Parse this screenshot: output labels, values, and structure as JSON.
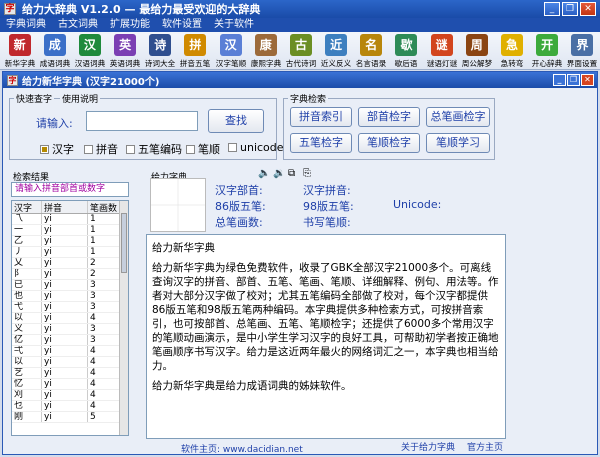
{
  "window": {
    "title": "给力大辞典 V1.2.0  — 最给力最受欢迎的大辞典"
  },
  "menu": [
    "字典词典",
    "古文词典",
    "扩展功能",
    "软件设置",
    "关于软件"
  ],
  "toolbar": [
    {
      "label": "新华字典",
      "icon": "dict-book-icon",
      "color": "#c0282d"
    },
    {
      "label": "成语词典",
      "icon": "idiom-book-icon",
      "color": "#3b6fc8"
    },
    {
      "label": "汉语词典",
      "icon": "chinese-book-icon",
      "color": "#1f8a3c"
    },
    {
      "label": "英语词典",
      "icon": "english-book-icon",
      "color": "#7b3fb3"
    },
    {
      "label": "诗词大全",
      "icon": "poem-icon",
      "color": "#2f4f8f"
    },
    {
      "label": "拼音五笔",
      "icon": "pinyin-icon",
      "color": "#d08a00"
    },
    {
      "label": "汉字笔顺",
      "icon": "stroke-icon",
      "color": "#5a7fd6"
    },
    {
      "label": "康熙字典",
      "icon": "kangxi-icon",
      "color": "#9c6a3a"
    },
    {
      "label": "古代诗词",
      "icon": "ancient-poem-icon",
      "color": "#6b8e23"
    },
    {
      "label": "近义反义",
      "icon": "synonym-icon",
      "color": "#3d7fbf"
    },
    {
      "label": "名言语录",
      "icon": "quote-icon",
      "color": "#b8860b"
    },
    {
      "label": "歇后语",
      "icon": "proverb-icon",
      "color": "#2e8b57"
    },
    {
      "label": "谜语灯谜",
      "icon": "riddle-icon",
      "color": "#d2451e"
    },
    {
      "label": "周公解梦",
      "icon": "dream-icon",
      "color": "#8b4513"
    },
    {
      "label": "急转弯",
      "icon": "brain-teaser-icon",
      "color": "#e0b000"
    },
    {
      "label": "开心辞典",
      "icon": "happy-dict-icon",
      "color": "#3caa3c"
    },
    {
      "label": "界面设置",
      "icon": "settings-gear-icon",
      "color": "#4a6fa5"
    }
  ],
  "subwindow": {
    "title": "给力新华字典    (汉字21000个)"
  },
  "quick_search": {
    "group_label": "快速查字",
    "help_label": "使用说明",
    "input_label": "请输入:",
    "input_value": "",
    "search_button": "查找",
    "modes": [
      {
        "label": "汉字",
        "checked": true
      },
      {
        "label": "拼音",
        "checked": false
      },
      {
        "label": "五笔编码",
        "checked": false
      },
      {
        "label": "笔顺",
        "checked": false
      },
      {
        "label": "unicode",
        "checked": false
      }
    ]
  },
  "char_search": {
    "group_label": "字典检索",
    "buttons": [
      "拼音索引",
      "部首检字",
      "总笔画检字",
      "五笔检字",
      "笔顺检字",
      "笔顺学习"
    ]
  },
  "results": {
    "group_label": "检索结果",
    "filter_placeholder": "请输入拼音部首或数字",
    "columns": [
      "汉字",
      "拼音",
      "笔画数"
    ],
    "rows": [
      [
        "乁",
        "yi",
        "1"
      ],
      [
        "一",
        "yi",
        "1"
      ],
      [
        "乙",
        "yi",
        "1"
      ],
      [
        "丿",
        "yi",
        "1"
      ],
      [
        "乂",
        "yi",
        "2"
      ],
      [
        "阝",
        "yi",
        "2"
      ],
      [
        "已",
        "yi",
        "3"
      ],
      [
        "也",
        "yi",
        "3"
      ],
      [
        "弋",
        "yi",
        "3"
      ],
      [
        "以",
        "yi",
        "4"
      ],
      [
        "义",
        "yi",
        "3"
      ],
      [
        "亿",
        "yi",
        "3"
      ],
      [
        "弌",
        "yi",
        "4"
      ],
      [
        "以",
        "yi",
        "4"
      ],
      [
        "艺",
        "yi",
        "4"
      ],
      [
        "忆",
        "yi",
        "4"
      ],
      [
        "刈",
        "yi",
        "4"
      ],
      [
        "乜",
        "yi",
        "4"
      ],
      [
        "刚",
        "yi",
        "5"
      ]
    ]
  },
  "dictionary": {
    "group_label": "给力字典",
    "fields": {
      "radical": "汉字部首:",
      "pinyin": "汉字拼音:",
      "wubi86": "86版五笔:",
      "wubi98": "98版五笔:",
      "unicode": "Unicode:",
      "strokes": "总笔画数:",
      "stroke_order": "书写笔顺:"
    },
    "content": [
      "给力新华字典",
      "给力新华字典为绿色免费软件，收录了GBK全部汉字21000多个。可离线查询汉字的拼音、部首、五笔、笔画、笔顺、详细解释、例句、用法等。作者对大部分汉字做了校对；尤其五笔编码全部做了校对，每个汉字都提供86版五笔和98版五笔两种编码。本字典提供多种检索方式，可按拼音索引，也可按部首、总笔画、五笔、笔顺检字；还提供了6000多个常用汉字的笔顺动画演示，是中小学生学习汉字的良好工具，可帮助初学者按正确地笔画顺序书写汉字。给力是这近两年最火的网络词汇之一，本字典也相当给力。",
      "给力新华字典是给力成语词典的姊妹软件。"
    ]
  },
  "footer": {
    "site": "软件主页: www.dacidian.net",
    "about": "关于给力字典",
    "official": "官方主页"
  }
}
